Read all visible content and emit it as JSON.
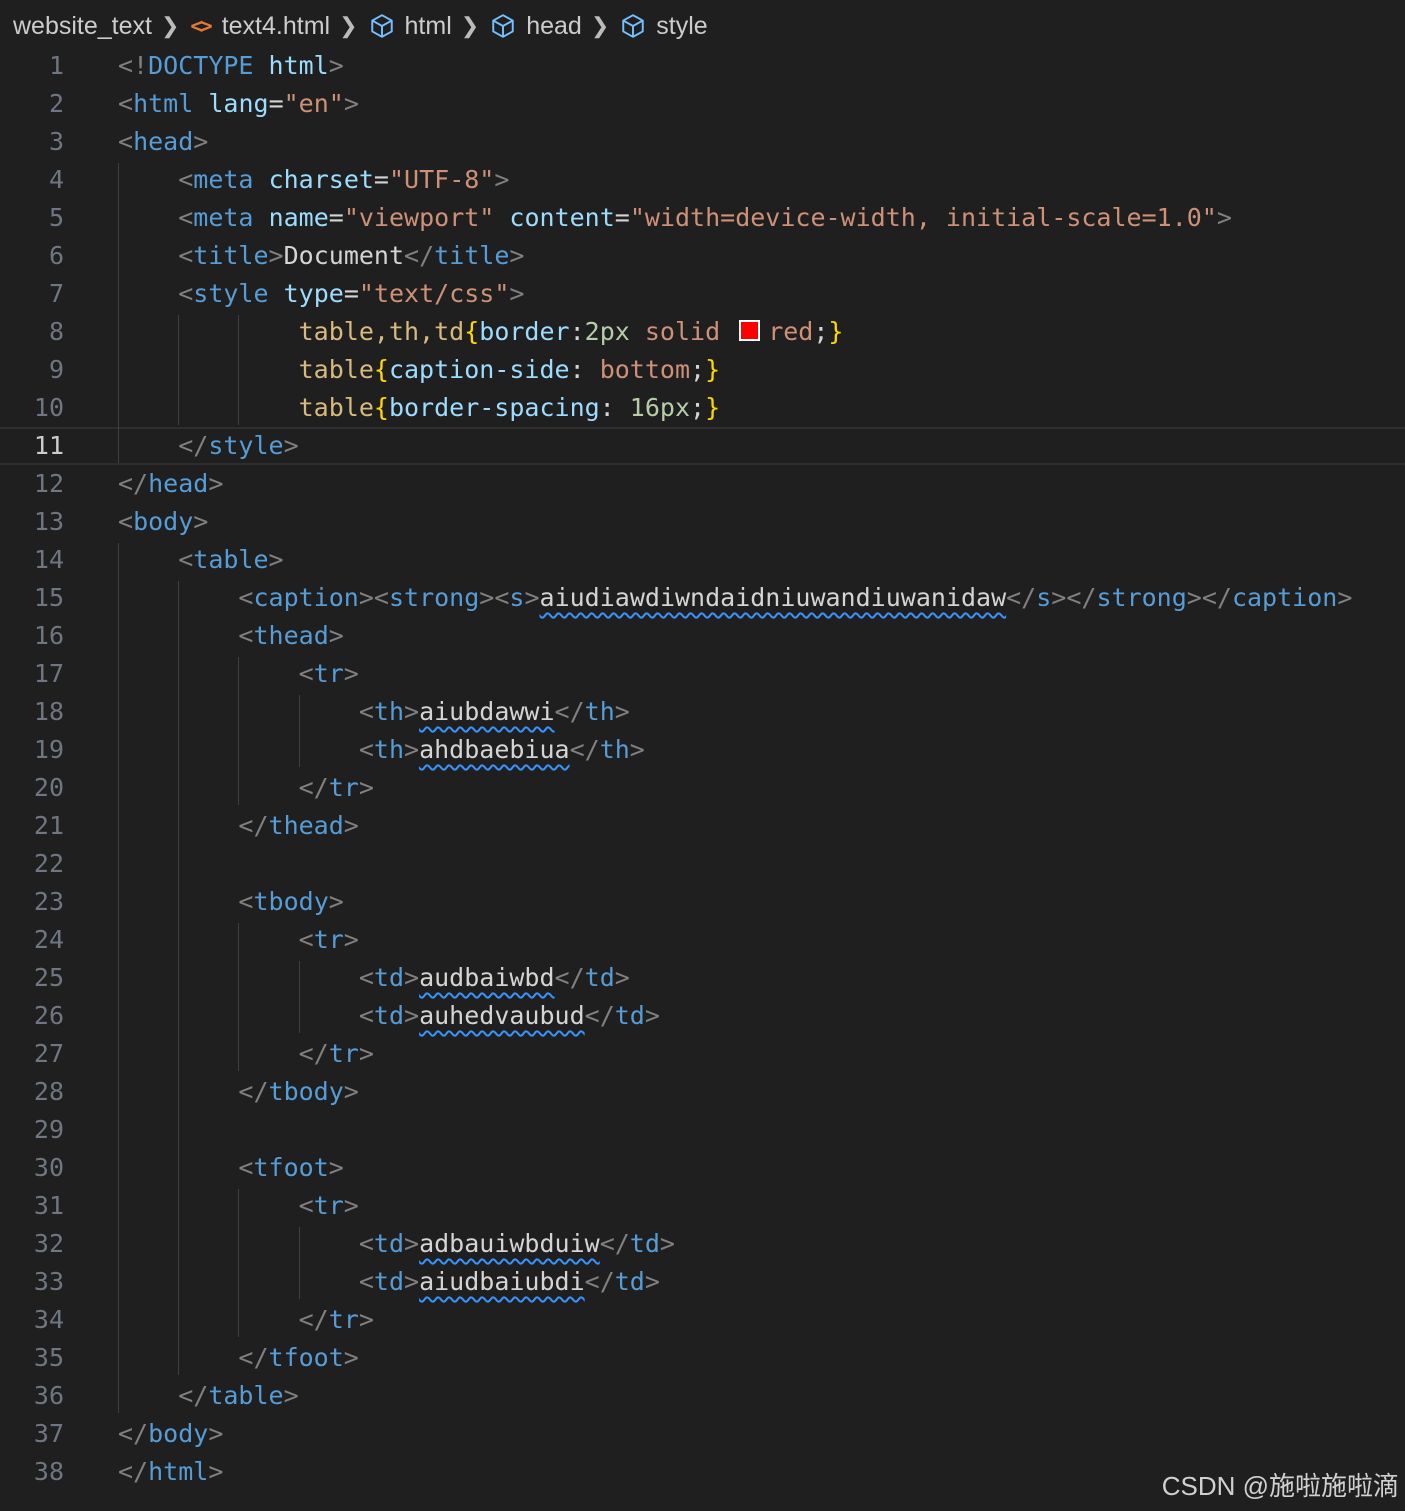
{
  "breadcrumb": {
    "folder": "website_text",
    "file": "text4.html",
    "path": [
      "html",
      "head",
      "style"
    ],
    "file_icon": "html-file-icon",
    "element_icon": "cube-icon",
    "separator_icon": "chevron-right-icon"
  },
  "editor": {
    "active_line": 11,
    "swatch_color": "#ff0000",
    "lines": [
      {
        "n": "1",
        "t": "<!DOCTYPE html>"
      },
      {
        "n": "2",
        "t": "<html lang=\"en\">"
      },
      {
        "n": "3",
        "t": "<head>"
      },
      {
        "n": "4",
        "t": "    <meta charset=\"UTF-8\">"
      },
      {
        "n": "5",
        "t": "    <meta name=\"viewport\" content=\"width=device-width, initial-scale=1.0\">"
      },
      {
        "n": "6",
        "t": "    <title>Document</title>"
      },
      {
        "n": "7",
        "t": "    <style type=\"text/css\">"
      },
      {
        "n": "8",
        "t": "            table,th,td{border:2px solid red;}"
      },
      {
        "n": "9",
        "t": "            table{caption-side: bottom;}"
      },
      {
        "n": "10",
        "t": "            table{border-spacing: 16px;}"
      },
      {
        "n": "11",
        "t": "    </style>"
      },
      {
        "n": "12",
        "t": "</head>"
      },
      {
        "n": "13",
        "t": "<body>"
      },
      {
        "n": "14",
        "t": "    <table>"
      },
      {
        "n": "15",
        "t": "        <caption><strong><s>aiudiawdiwndaidniuwandiuwanidaw</s></strong></caption>"
      },
      {
        "n": "16",
        "t": "        <thead>"
      },
      {
        "n": "17",
        "t": "            <tr>"
      },
      {
        "n": "18",
        "t": "                <th>aiubdawwi</th>"
      },
      {
        "n": "19",
        "t": "                <th>ahdbaebiua</th>"
      },
      {
        "n": "20",
        "t": "            </tr>"
      },
      {
        "n": "21",
        "t": "        </thead>"
      },
      {
        "n": "22",
        "t": ""
      },
      {
        "n": "23",
        "t": "        <tbody>"
      },
      {
        "n": "24",
        "t": "            <tr>"
      },
      {
        "n": "25",
        "t": "                <td>audbaiwbd</td>"
      },
      {
        "n": "26",
        "t": "                <td>auhedvaubud</td>"
      },
      {
        "n": "27",
        "t": "            </tr>"
      },
      {
        "n": "28",
        "t": "        </tbody>"
      },
      {
        "n": "29",
        "t": ""
      },
      {
        "n": "30",
        "t": "        <tfoot>"
      },
      {
        "n": "31",
        "t": "            <tr>"
      },
      {
        "n": "32",
        "t": "                <td>adbauiwbduiw</td>"
      },
      {
        "n": "33",
        "t": "                <td>aiudbaiubdi</td>"
      },
      {
        "n": "34",
        "t": "            </tr>"
      },
      {
        "n": "35",
        "t": "        </tfoot>"
      },
      {
        "n": "36",
        "t": "    </table>"
      },
      {
        "n": "37",
        "t": "</body>"
      },
      {
        "n": "38",
        "t": "</html>"
      }
    ]
  },
  "watermark": "CSDN @施啦施啦滴"
}
